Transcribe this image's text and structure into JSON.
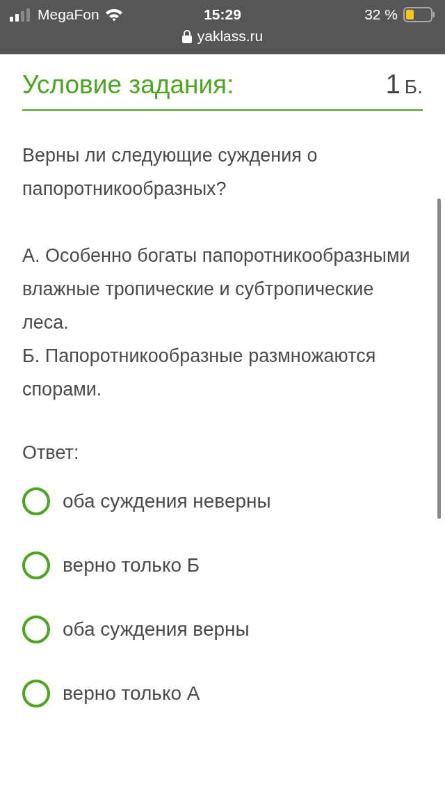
{
  "status_bar": {
    "carrier": "MegaFon",
    "time": "15:29",
    "battery": "32 %",
    "url": "yaklass.ru"
  },
  "task": {
    "title": "Условие задания:",
    "points_value": "1",
    "points_unit": "Б.",
    "paragraphs": [
      "Верны ли следующие суждения о папоротникообразных?",
      "А. Особенно богаты папоротникообразными влажные тропические и субтропические леса.",
      "Б. Папоротникообразные размножаются спорами."
    ],
    "answer_label": "Ответ:",
    "options": [
      {
        "label": "оба суждения неверны",
        "selected": false
      },
      {
        "label": "верно только Б",
        "selected": false
      },
      {
        "label": "оба суждения верны",
        "selected": false
      },
      {
        "label": "верно только А",
        "selected": false
      }
    ]
  }
}
